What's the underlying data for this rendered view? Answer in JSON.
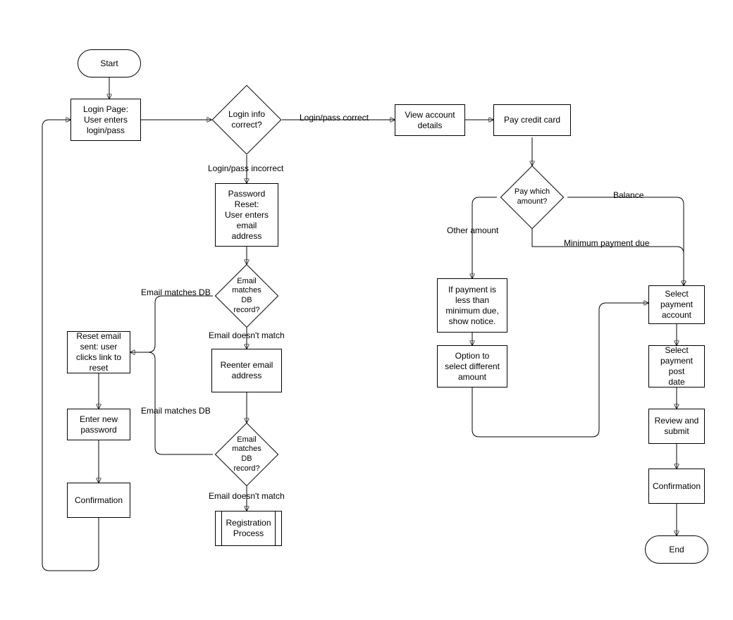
{
  "nodes": {
    "start": "Start",
    "login_page": "Login Page:\nUser enters\nlogin/pass",
    "login_decision": "Login info\ncorrect?",
    "view_account": "View account\ndetails",
    "pay_card": "Pay credit card",
    "pay_which": "Pay which\namount?",
    "password_reset": "Password\nReset:\nUser enters\nemail\naddress",
    "email_match1": "Email matches\nDB record?",
    "reset_email": "Reset email\nsent: user\nclicks link to\nreset",
    "enter_new_pw": "Enter new\npassword",
    "confirmation_left": "Confirmation",
    "reenter_email": "Reenter email\naddress",
    "email_match2": "Email matches\nDB record?",
    "registration": "Registration\nProcess",
    "notice_min": "If payment is\nless than\nminimum due,\nshow notice.",
    "option_diff": "Option to\nselect different\namount",
    "select_pay_acct": "Select\npayment\naccount",
    "select_post_date": "Select\npayment post\ndate",
    "review_submit": "Review and\nsubmit",
    "confirmation_right": "Confirmation",
    "end": "End"
  },
  "edges": {
    "login_correct": "Login/pass correct",
    "login_incorrect": "Login/pass incorrect",
    "email_matches1": "Email matches DB",
    "email_nomatch1": "Email doesn't match",
    "email_matches2": "Email matches DB",
    "email_nomatch2": "Email doesn't match",
    "other_amount": "Other amount",
    "balance": "Balance",
    "min_due": "Minimum payment due"
  }
}
